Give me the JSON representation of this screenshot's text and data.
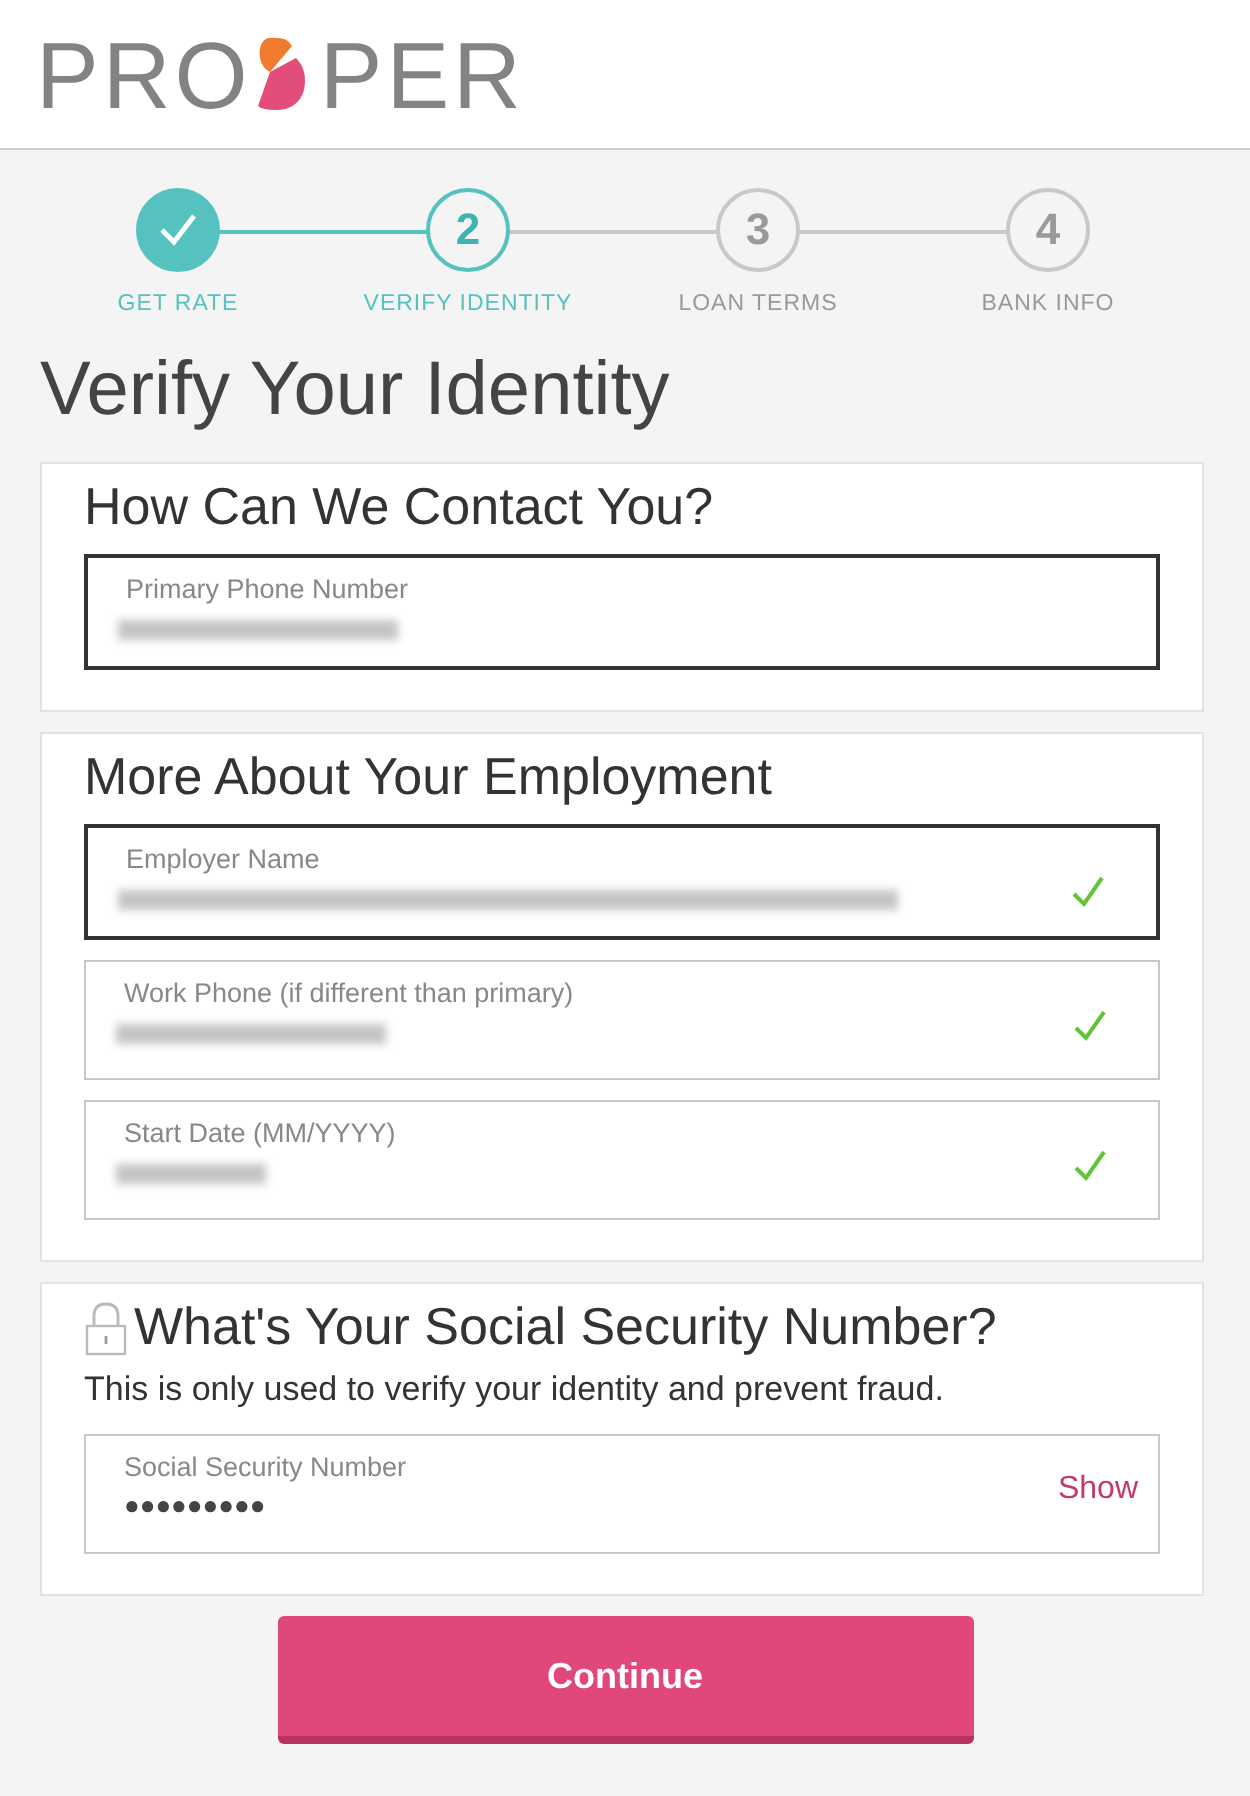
{
  "logo": {
    "before": "PRO",
    "after": "PER"
  },
  "steps": [
    {
      "label": "GET RATE",
      "completed": true,
      "selected": false
    },
    {
      "label": "VERIFY IDENTITY",
      "number": "2",
      "completed": false,
      "selected": true
    },
    {
      "label": "LOAN TERMS",
      "number": "3",
      "completed": false,
      "selected": false
    },
    {
      "label": "BANK INFO",
      "number": "4",
      "completed": false,
      "selected": false
    }
  ],
  "page_title": "Verify Your Identity",
  "sections": [
    {
      "heading": "How Can We Contact You?",
      "fields": [
        {
          "label": "Primary Phone Number",
          "kind": "redacted",
          "focused": true,
          "valid": false
        }
      ]
    },
    {
      "heading": "More About Your Employment",
      "fields": [
        {
          "label": "Employer Name",
          "kind": "redacted",
          "focused": true,
          "valid": true
        },
        {
          "label": "Work Phone (if different than primary)",
          "kind": "redacted",
          "focused": false,
          "valid": true
        },
        {
          "label": "Start Date (MM/YYYY)",
          "kind": "redacted",
          "focused": false,
          "valid": true
        }
      ]
    },
    {
      "heading": "What's Your Social Security Number?",
      "locked": true,
      "description": "This is only used to verify your identity and prevent fraud.",
      "fields": [
        {
          "label": "Social Security Number",
          "kind": "masked",
          "value": "●●●●●●●●●",
          "action": "Show",
          "focused": false,
          "valid": false
        }
      ]
    }
  ],
  "continue_button": "Continue"
}
